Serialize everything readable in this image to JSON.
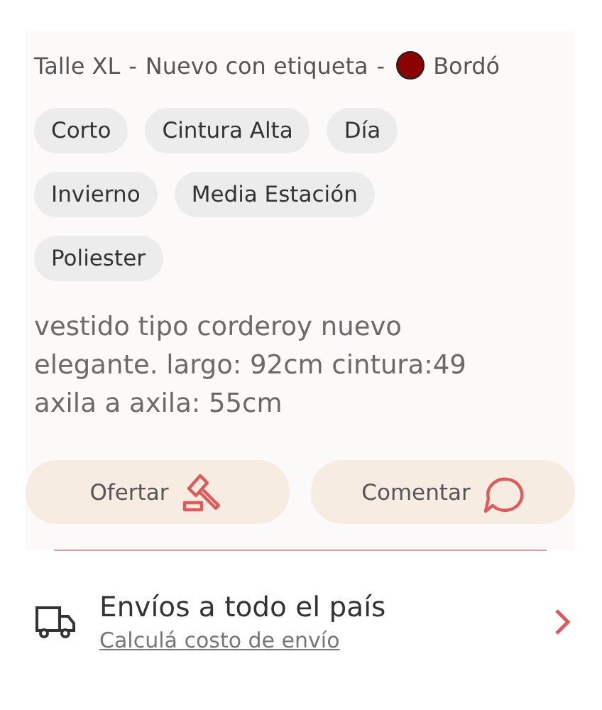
{
  "details": {
    "size": "Talle XL",
    "separator_1": "-",
    "condition": "Nuevo con etiqueta",
    "separator_2": "-",
    "color_name": "Bordó",
    "color": "#8b0000"
  },
  "tags": [
    "Corto",
    "Cintura Alta",
    "Día",
    "Invierno",
    "Media Estación",
    "Poliester"
  ],
  "description": "vestido tipo corderoy nuevo elegante. largo: 92cm cintura:49 axila a axila: 55cm",
  "actions": [
    {
      "label": "Ofertar",
      "kind": "offer"
    },
    {
      "label": "Comentar",
      "kind": "comment"
    }
  ],
  "shipping": {
    "title": "Envíos a todo el país",
    "link": "Calculá costo de envío"
  }
}
